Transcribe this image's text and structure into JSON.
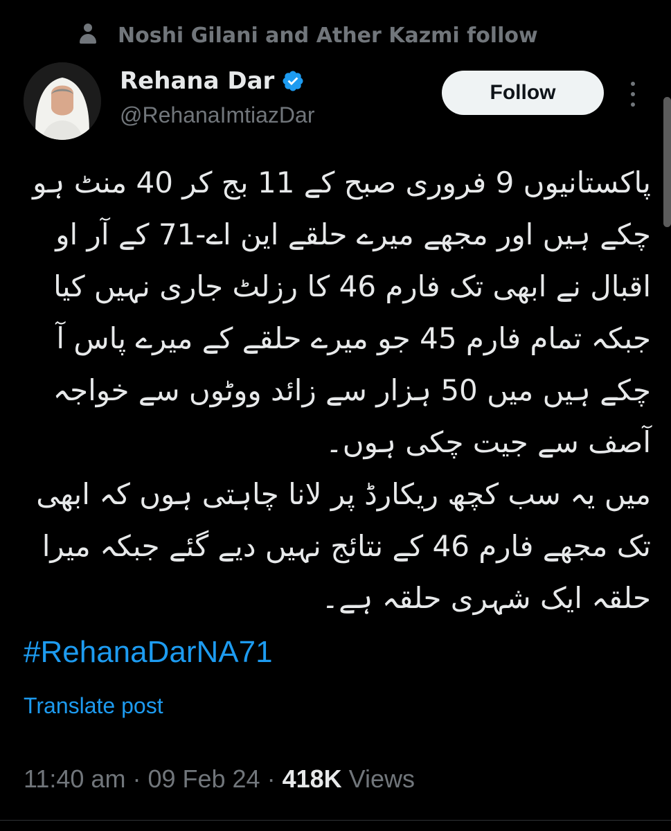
{
  "social_context": {
    "text": "Noshi Gilani and Ather Kazmi follow"
  },
  "author": {
    "display_name": "Rehana Dar",
    "handle": "@RehanaImtiazDar",
    "verified": true
  },
  "follow_button": {
    "label": "Follow"
  },
  "post": {
    "paragraphs": [
      "پاکستانیوں 9 فروری صبح کے 11 بج کر 40 منٹ ہو چکے ہیں اور مجھے میرے حلقے این اے-71 کے آر او  اقبال نے ابھی تک فارم 46 کا رزلٹ جاری نہیں کیا جبکہ تمام فارم 45 جو میرے حلقے کے میرے پاس آ چکے ہیں میں 50 ہزار سے زائد ووٹوں سے خواجہ آصف سے جیت چکی ہوں۔",
      "میں یہ سب کچھ ریکارڈ پر لانا چاہتی ہوں کہ ابھی تک مجھے فارم 46 کے نتائج نہیں دیے گئے جبکہ میرا حلقہ ایک شہری حلقہ ہے۔"
    ],
    "hashtag": "#RehanaDarNA71",
    "translate_label": "Translate post"
  },
  "meta": {
    "time": "11:40 am",
    "separator": "·",
    "date": "09 Feb 24",
    "views_count": "418K",
    "views_label": "Views"
  },
  "colors": {
    "background": "#000000",
    "link": "#1d9bf0",
    "muted": "#71767b",
    "verified": "#1d9bf0"
  },
  "icons": {
    "social_context": "person-icon",
    "verified": "verified-badge-icon",
    "more": "more-icon"
  }
}
